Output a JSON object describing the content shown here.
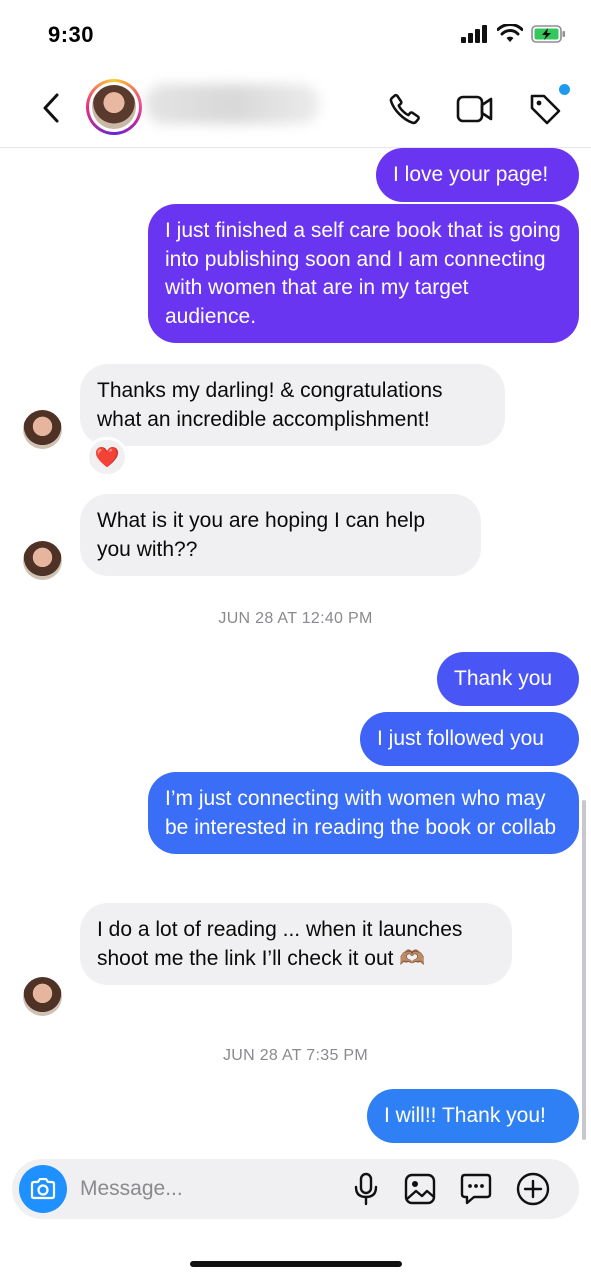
{
  "status_bar": {
    "time": "9:30"
  },
  "header": {
    "contact_name": ""
  },
  "messages": [
    {
      "id": "m1",
      "from": "me",
      "text": "I love your page!",
      "color": "#6a35f0"
    },
    {
      "id": "m2",
      "from": "me",
      "text": "I just finished a self care book that is going into publishing soon and I am connecting with women that are in my target audience.",
      "color": "#6a35f0"
    },
    {
      "id": "m3",
      "from": "them",
      "text": "Thanks my darling! & congratulations what an incredible accomplishment!",
      "reaction": "❤️"
    },
    {
      "id": "m4",
      "from": "them",
      "text": "What is it you are hoping I can help you with??"
    },
    {
      "id": "t1",
      "type": "timestamp",
      "text": "JUN 28 AT 12:40 PM"
    },
    {
      "id": "m5",
      "from": "me",
      "text": "Thank you",
      "color": "#4a55f5"
    },
    {
      "id": "m6",
      "from": "me",
      "text": "I just followed you",
      "color": "#3f63f6"
    },
    {
      "id": "m7",
      "from": "me",
      "text": "I’m just connecting with women who may be interested in reading the book or collab",
      "color": "#3a6ef6"
    },
    {
      "id": "m8",
      "from": "them",
      "text": "I do a lot of reading ... when it launches shoot me the link I’ll check it out 🫶🏽"
    },
    {
      "id": "t2",
      "type": "timestamp",
      "text": "JUN 28 AT 7:35 PM"
    },
    {
      "id": "m9",
      "from": "me",
      "text": "I will!! Thank you!",
      "color": "#2f80f5"
    }
  ],
  "composer": {
    "placeholder": "Message..."
  },
  "icons": {
    "back": "chevron-left-icon",
    "call": "phone-icon",
    "video": "video-camera-icon",
    "tag": "tag-icon",
    "camera": "camera-icon",
    "mic": "microphone-icon",
    "gallery": "image-icon",
    "sticker": "chat-bubble-icon",
    "more": "plus-circle-icon"
  },
  "colors": {
    "notification_dot": "#1e9bf0",
    "camera_button": "#1e90ff"
  }
}
